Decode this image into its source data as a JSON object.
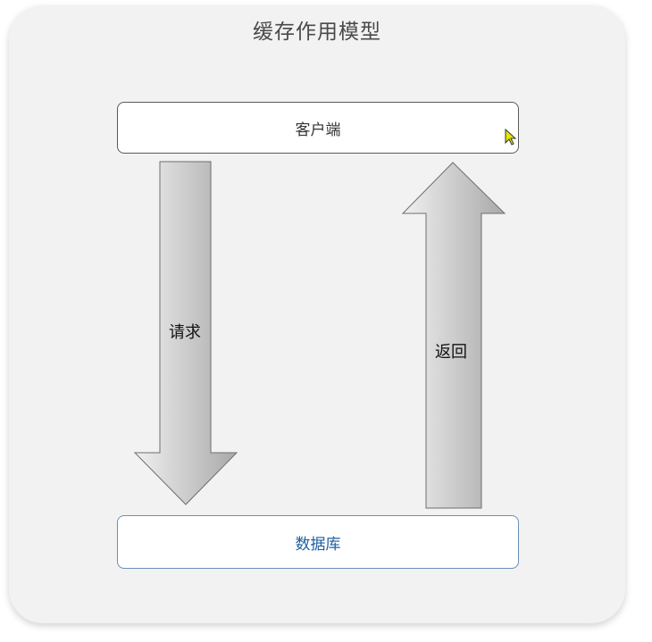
{
  "diagram": {
    "title": "缓存作用模型",
    "client_label": "客户端",
    "database_label": "数据库",
    "request_label": "请求",
    "return_label": "返回"
  },
  "colors": {
    "panel": "#f2f2f2",
    "arrow_light": "#f0f0f0",
    "arrow_dark": "#a9a9a9",
    "database_text": "#1f5fa0",
    "database_border": "#6a8fb8"
  },
  "icons": {
    "cursor": "mouse-pointer-icon"
  }
}
